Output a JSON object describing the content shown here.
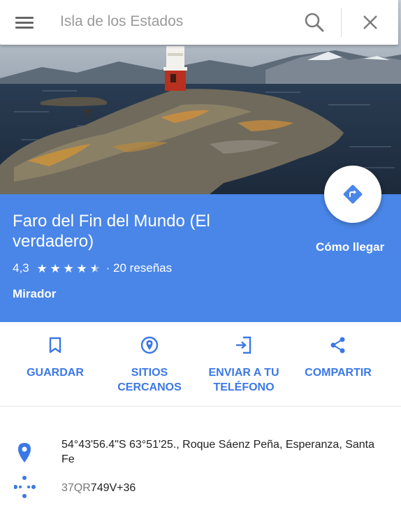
{
  "search": {
    "placeholder": "Isla de los Estados",
    "value": ""
  },
  "place": {
    "title": "Faro del Fin del Mundo (El verdadero)",
    "rating": "4,3",
    "rating_value": 4.3,
    "reviews": "· 20 reseñas",
    "category": "Mirador",
    "directions_label": "Cómo llegar"
  },
  "actions": [
    {
      "label": "GUARDAR",
      "icon": "bookmark-icon"
    },
    {
      "label": "SITIOS CERCANOS",
      "icon": "nearby-icon"
    },
    {
      "label": "ENVIAR A TU TELÉFONO",
      "icon": "send-to-phone-icon"
    },
    {
      "label": "COMPARTIR",
      "icon": "share-icon"
    }
  ],
  "info": {
    "address": "54°43'56.4\"S 63°51'25., Roque Sáenz Peña, Esperanza, Santa Fe",
    "pluscode_prefix": "37QR",
    "pluscode_main": "749V+36"
  },
  "colors": {
    "header_blue": "#4a86e8",
    "action_blue": "#3b78e7",
    "icon_grey": "#666666"
  }
}
